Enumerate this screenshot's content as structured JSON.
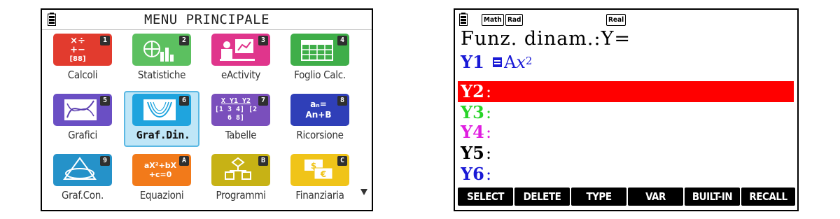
{
  "menu": {
    "title": "MENU PRINCIPALE",
    "items": [
      {
        "label": "Calcoli",
        "num": "1",
        "color": "#e23b2e"
      },
      {
        "label": "Statistiche",
        "num": "2",
        "color": "#4caf50"
      },
      {
        "label": "eActivity",
        "num": "3",
        "color": "#e0358c"
      },
      {
        "label": "Foglio Calc.",
        "num": "4",
        "color": "#3fae49"
      },
      {
        "label": "Grafici",
        "num": "5",
        "color": "#5b3fb0"
      },
      {
        "label": "Graf.Din.",
        "num": "6",
        "color": "#1fa4de",
        "selected": true
      },
      {
        "label": "Tabelle",
        "num": "7",
        "color": "#6a3fa6"
      },
      {
        "label": "Ricorsione",
        "num": "8",
        "color": "#2f3fb8"
      },
      {
        "label": "Graf.Con.",
        "num": "9",
        "color": "#2592c9"
      },
      {
        "label": "Equazioni",
        "num": "A",
        "color": "#f27a1a"
      },
      {
        "label": "Programmi",
        "num": "B",
        "color": "#c7b215"
      },
      {
        "label": "Finanziaria",
        "num": "C",
        "color": "#f0c419"
      }
    ],
    "tile_texts": {
      "calcoli_top": "×÷",
      "calcoli_mid": "+−",
      "calcoli_box": "[88]",
      "tabelle_head": "X Y1 Y2",
      "tabelle_body": "[1 3 4] [2 6 8]",
      "ricorsione_top": "aₙ=",
      "ricorsione_bottom": "An+B",
      "equazioni_top": "aX²+bX",
      "equazioni_bottom": "+c=0"
    },
    "scroll_icon": "scroll-down-arrow-icon"
  },
  "graph_screen": {
    "status": {
      "math": "Math",
      "rad": "Rad",
      "real": "Real"
    },
    "title": "Funz. dinam.:Y=",
    "rows": [
      {
        "name": "Y1",
        "color": "#1a1ad6",
        "expr_base": "A",
        "expr_var": "x",
        "expr_exp": "2",
        "selected": true
      },
      {
        "name": "Y2",
        "color": "#ffffff",
        "highlighted": true
      },
      {
        "name": "Y3",
        "color": "#28d428"
      },
      {
        "name": "Y4",
        "color": "#e01ee0"
      },
      {
        "name": "Y5",
        "color": "#000000"
      },
      {
        "name": "Y6",
        "color": "#1a1ad6"
      }
    ],
    "fkeys": [
      "SELECT",
      "DELETE",
      "TYPE",
      "VAR",
      "BUILT-IN",
      "RECALL"
    ],
    "colon": ":"
  }
}
